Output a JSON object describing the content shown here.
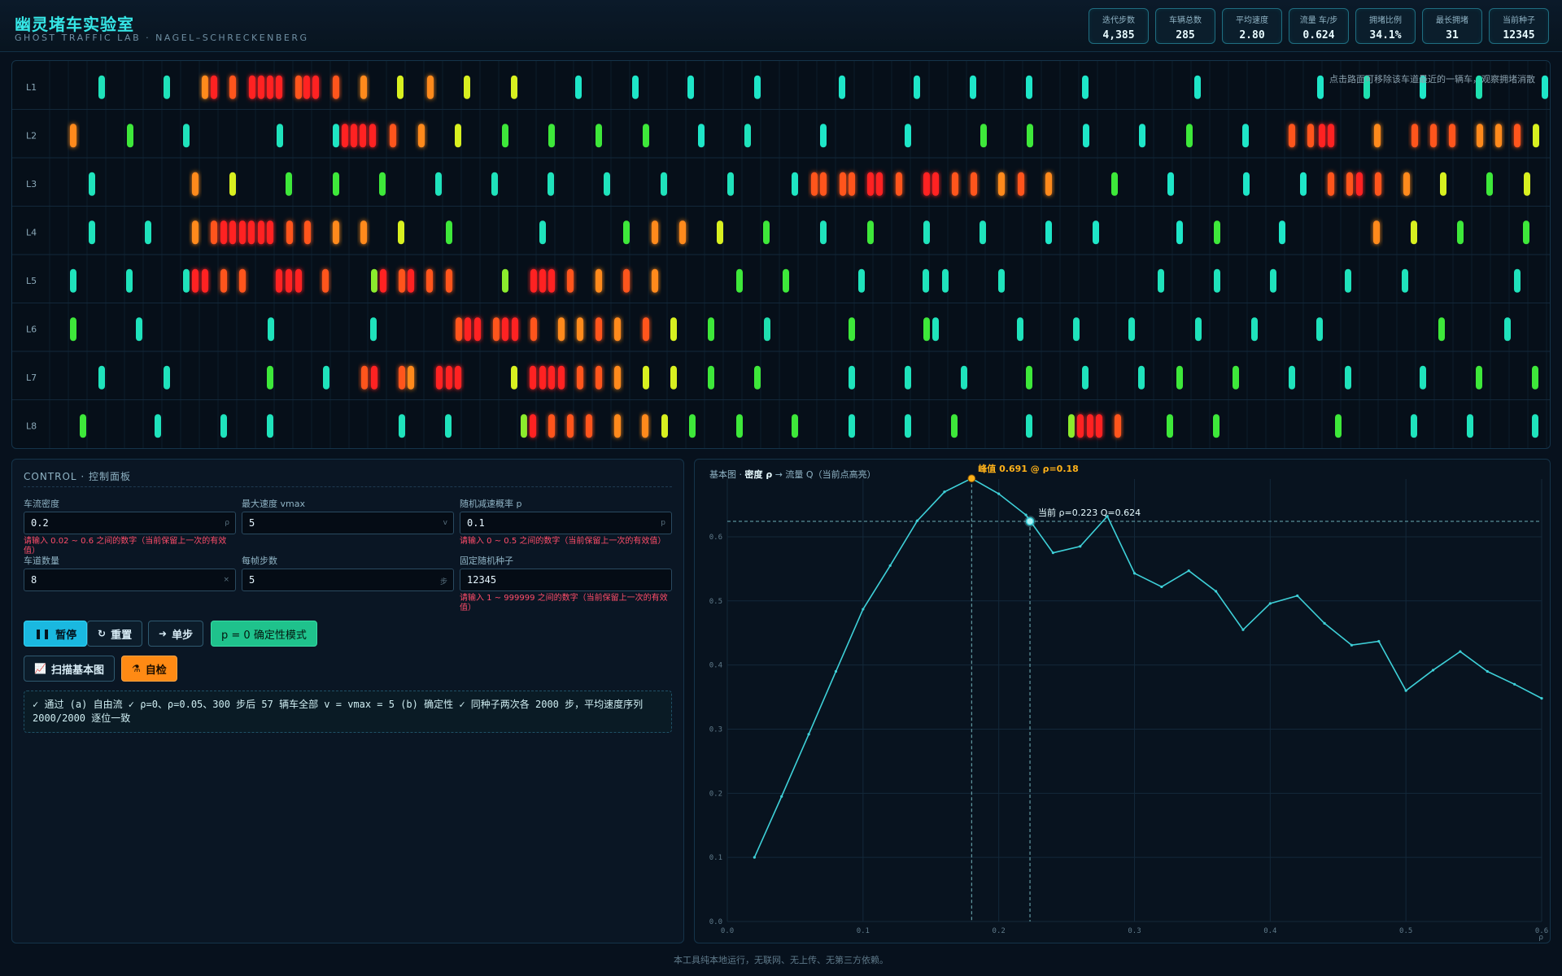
{
  "app": {
    "title": "幽灵堵车实验室",
    "subtitle": "GHOST TRAFFIC LAB · NAGEL–SCHRECKENBERG"
  },
  "stats": [
    {
      "label": "迭代步数",
      "value": "4,385"
    },
    {
      "label": "车辆总数",
      "value": "285"
    },
    {
      "label": "平均速度",
      "value": "2.80"
    },
    {
      "label": "流量 车/步",
      "value": "0.624"
    },
    {
      "label": "拥堵比例",
      "value": "34.1%"
    },
    {
      "label": "最长拥堵",
      "value": "31"
    },
    {
      "label": "当前种子",
      "value": "12345"
    }
  ],
  "road": {
    "hint": "点击路面可移除该车道最近的一辆车，观察拥堵消散",
    "lane_labels": [
      "L1",
      "L2",
      "L3",
      "L4",
      "L5",
      "L6",
      "L7",
      "L8"
    ],
    "cars": [
      [
        [
          124,
          0.6
        ],
        [
          204,
          0.6
        ],
        [
          251,
          4
        ],
        [
          262,
          5
        ],
        [
          285,
          4.5
        ],
        [
          309,
          5
        ],
        [
          320,
          5
        ],
        [
          331,
          5
        ],
        [
          342,
          5
        ],
        [
          366,
          4.5
        ],
        [
          376,
          5
        ],
        [
          387,
          5
        ],
        [
          412,
          4.5
        ],
        [
          446,
          4
        ],
        [
          491,
          3
        ],
        [
          528,
          4
        ],
        [
          573,
          3
        ],
        [
          631,
          3
        ],
        [
          710,
          0
        ],
        [
          780,
          0
        ],
        [
          848,
          0
        ],
        [
          930,
          0
        ],
        [
          1034,
          0
        ],
        [
          1126,
          0
        ],
        [
          1195,
          0
        ],
        [
          1264,
          0
        ],
        [
          1333,
          0
        ],
        [
          1471,
          0
        ],
        [
          1622,
          0
        ],
        [
          1679,
          1
        ],
        [
          1748,
          0
        ],
        [
          1817,
          1
        ],
        [
          1898,
          0
        ]
      ],
      [
        [
          89,
          4
        ],
        [
          159,
          2
        ],
        [
          228,
          0.5
        ],
        [
          343,
          0.5
        ],
        [
          412,
          0.2
        ],
        [
          423,
          5
        ],
        [
          434,
          5
        ],
        [
          445,
          5
        ],
        [
          457,
          5
        ],
        [
          482,
          4.5
        ],
        [
          517,
          4
        ],
        [
          562,
          3
        ],
        [
          620,
          2
        ],
        [
          677,
          2
        ],
        [
          735,
          2
        ],
        [
          793,
          2
        ],
        [
          861,
          0
        ],
        [
          918,
          0.5
        ],
        [
          1011,
          0
        ],
        [
          1115,
          0
        ],
        [
          1208,
          2
        ],
        [
          1265,
          2
        ],
        [
          1334,
          0
        ],
        [
          1403,
          0
        ],
        [
          1461,
          2
        ],
        [
          1530,
          0
        ],
        [
          1587,
          4.5
        ],
        [
          1610,
          4.5
        ],
        [
          1624,
          5
        ],
        [
          1635,
          5
        ],
        [
          1692,
          4
        ],
        [
          1738,
          4.5
        ],
        [
          1761,
          4.5
        ],
        [
          1784,
          4.5
        ],
        [
          1818,
          4
        ],
        [
          1841,
          4
        ],
        [
          1864,
          4.5
        ],
        [
          1887,
          3
        ]
      ]
    ],
    "cars_more": [
      [
        [
          112,
          0.5
        ],
        [
          239,
          4
        ],
        [
          285,
          3
        ],
        [
          354,
          2
        ],
        [
          412,
          2
        ],
        [
          469,
          2
        ],
        [
          538,
          0.5
        ],
        [
          607,
          0.5
        ],
        [
          676,
          0.5
        ],
        [
          745,
          0.5
        ],
        [
          815,
          0.5
        ],
        [
          897,
          0.5
        ],
        [
          976,
          0.2
        ],
        [
          1000,
          4.5
        ],
        [
          1011,
          4.5
        ],
        [
          1035,
          4.5
        ],
        [
          1046,
          4.5
        ],
        [
          1069,
          5
        ],
        [
          1080,
          5
        ],
        [
          1104,
          4.5
        ],
        [
          1138,
          5
        ],
        [
          1149,
          5
        ],
        [
          1173,
          4.5
        ],
        [
          1196,
          4.5
        ],
        [
          1230,
          4
        ],
        [
          1254,
          4.5
        ],
        [
          1288,
          4
        ],
        [
          1369,
          2
        ],
        [
          1438,
          0
        ],
        [
          1531,
          0
        ],
        [
          1601,
          0
        ],
        [
          1635,
          4.5
        ],
        [
          1658,
          4.5
        ],
        [
          1670,
          5
        ],
        [
          1693,
          4.5
        ],
        [
          1728,
          4
        ],
        [
          1773,
          3
        ],
        [
          1830,
          2
        ],
        [
          1876,
          3
        ]
      ],
      [
        [
          112,
          0.5
        ],
        [
          181,
          0.5
        ],
        [
          239,
          4
        ],
        [
          262,
          4.5
        ],
        [
          274,
          5
        ],
        [
          285,
          5
        ],
        [
          297,
          5
        ],
        [
          308,
          5
        ],
        [
          320,
          5
        ],
        [
          331,
          5
        ],
        [
          355,
          4.5
        ],
        [
          377,
          4.5
        ],
        [
          412,
          4
        ],
        [
          446,
          4
        ],
        [
          492,
          3
        ],
        [
          551,
          2
        ],
        [
          666,
          0.5
        ],
        [
          769,
          2
        ],
        [
          804,
          4
        ],
        [
          838,
          4
        ],
        [
          884,
          3
        ],
        [
          941,
          2
        ],
        [
          1011,
          0.5
        ],
        [
          1069,
          2
        ],
        [
          1138,
          0.5
        ],
        [
          1207,
          0.5
        ],
        [
          1288,
          0
        ],
        [
          1346,
          0
        ],
        [
          1449,
          0
        ],
        [
          1495,
          2
        ],
        [
          1575,
          0
        ],
        [
          1691,
          4
        ],
        [
          1737,
          3
        ],
        [
          1794,
          2
        ],
        [
          1875,
          2
        ]
      ],
      [
        [
          89,
          0.5
        ],
        [
          158,
          0.5
        ],
        [
          228,
          0.5
        ],
        [
          239,
          5
        ],
        [
          251,
          5
        ],
        [
          274,
          4.5
        ],
        [
          297,
          4.5
        ],
        [
          342,
          5
        ],
        [
          354,
          5
        ],
        [
          366,
          5
        ],
        [
          399,
          4.5
        ],
        [
          459,
          2.5
        ],
        [
          470,
          5
        ],
        [
          493,
          4.5
        ],
        [
          504,
          5
        ],
        [
          527,
          4.5
        ],
        [
          551,
          4.5
        ],
        [
          620,
          2.5
        ],
        [
          655,
          5
        ],
        [
          666,
          5
        ],
        [
          677,
          5
        ],
        [
          700,
          4.5
        ],
        [
          735,
          4
        ],
        [
          769,
          4.5
        ],
        [
          804,
          4
        ],
        [
          908,
          2
        ],
        [
          965,
          2
        ],
        [
          1058,
          0.5
        ],
        [
          1137,
          0.5
        ],
        [
          1161,
          0.5
        ],
        [
          1230,
          0.5
        ],
        [
          1426,
          0.5
        ],
        [
          1495,
          0.5
        ],
        [
          1564,
          0.5
        ],
        [
          1656,
          0.5
        ],
        [
          1726,
          0.5
        ],
        [
          1864,
          0.5
        ]
      ],
      [
        [
          89,
          2
        ],
        [
          170,
          0.5
        ],
        [
          332,
          0.5
        ],
        [
          458,
          0.5
        ],
        [
          563,
          4.5
        ],
        [
          574,
          5
        ],
        [
          586,
          5
        ],
        [
          609,
          4.5
        ],
        [
          620,
          5
        ],
        [
          632,
          5
        ],
        [
          655,
          4.5
        ],
        [
          689,
          4
        ],
        [
          712,
          4
        ],
        [
          735,
          4.5
        ],
        [
          758,
          4
        ],
        [
          793,
          4.5
        ],
        [
          827,
          3
        ],
        [
          873,
          2
        ],
        [
          942,
          1
        ],
        [
          1046,
          2
        ],
        [
          1138,
          2
        ],
        [
          1149,
          0.5
        ],
        [
          1253,
          0.5
        ],
        [
          1322,
          0.5
        ],
        [
          1390,
          0.5
        ],
        [
          1472,
          0.5
        ],
        [
          1541,
          0.5
        ],
        [
          1621,
          0.5
        ],
        [
          1771,
          2
        ],
        [
          1852,
          0.5
        ]
      ],
      [
        [
          124,
          0.5
        ],
        [
          204,
          0.5
        ],
        [
          331,
          2
        ],
        [
          400,
          0.5
        ],
        [
          447,
          4.5
        ],
        [
          459,
          5
        ],
        [
          493,
          4.5
        ],
        [
          504,
          4
        ],
        [
          539,
          5
        ],
        [
          551,
          5
        ],
        [
          562,
          5
        ],
        [
          631,
          3
        ],
        [
          654,
          5
        ],
        [
          666,
          5
        ],
        [
          677,
          5
        ],
        [
          689,
          5
        ],
        [
          712,
          4.5
        ],
        [
          735,
          4.5
        ],
        [
          758,
          4
        ],
        [
          793,
          3
        ],
        [
          827,
          3
        ],
        [
          873,
          2
        ],
        [
          930,
          2
        ],
        [
          1046,
          0.5
        ],
        [
          1115,
          0.5
        ],
        [
          1184,
          0.5
        ],
        [
          1264,
          2
        ],
        [
          1333,
          0.5
        ],
        [
          1402,
          0.5
        ],
        [
          1449,
          2
        ],
        [
          1518,
          2
        ],
        [
          1587,
          0.5
        ],
        [
          1656,
          0.5
        ],
        [
          1748,
          0.5
        ],
        [
          1817,
          2
        ],
        [
          1886,
          2
        ]
      ],
      [
        [
          101,
          2
        ],
        [
          193,
          0.5
        ],
        [
          274,
          0.5
        ],
        [
          331,
          0.5
        ],
        [
          493,
          0.5
        ],
        [
          550,
          0.5
        ],
        [
          643,
          2.5
        ],
        [
          654,
          5
        ],
        [
          677,
          4.5
        ],
        [
          700,
          4.5
        ],
        [
          723,
          4.5
        ],
        [
          758,
          4
        ],
        [
          792,
          4
        ],
        [
          816,
          3
        ],
        [
          850,
          2
        ],
        [
          908,
          2
        ],
        [
          976,
          2
        ],
        [
          1046,
          0.5
        ],
        [
          1115,
          0.5
        ],
        [
          1172,
          2
        ],
        [
          1264,
          0.5
        ],
        [
          1316,
          2.5
        ],
        [
          1327,
          5
        ],
        [
          1339,
          5
        ],
        [
          1350,
          5
        ],
        [
          1373,
          4.5
        ],
        [
          1437,
          2
        ],
        [
          1494,
          2
        ],
        [
          1644,
          2
        ],
        [
          1737,
          0.5
        ],
        [
          1806,
          0.5
        ],
        [
          1886,
          0.5
        ]
      ]
    ]
  },
  "controls": {
    "title": "CONTROL · 控制面板",
    "fields": [
      {
        "label": "车流密度",
        "value": "0.2",
        "unit": "ρ",
        "error": "请输入 0.02 ~ 0.6 之间的数字（当前保留上一次的有效值）"
      },
      {
        "label": "最大速度 vmax",
        "value": "5",
        "unit": "v",
        "error": ""
      },
      {
        "label": "随机减速概率 p",
        "value": "0.1",
        "unit": "p",
        "error": "请输入 0 ~ 0.5 之间的数字（当前保留上一次的有效值）"
      },
      {
        "label": "车道数量",
        "value": "8",
        "unit": "×",
        "error": ""
      },
      {
        "label": "每帧步数",
        "value": "5",
        "unit": "步",
        "error": ""
      },
      {
        "label": "固定随机种子",
        "value": "12345",
        "unit": "",
        "error": "请输入 1 ~ 999999 之间的数字（当前保留上一次的有效值）"
      }
    ],
    "buttons": {
      "pause": "暂停",
      "reset": "重置",
      "step": "单步",
      "deterministic": "p = 0 确定性模式",
      "sweep": "扫描基本图",
      "selftest": "自检"
    },
    "result": "✓ 通过 (a) 自由流 ✓ ρ=0、ρ=0.05、300 步后 57 辆车全部 v = vmax = 5 (b) 确定性 ✓ 同种子两次各 2000 步，平均速度序列 2000/2000 逐位一致"
  },
  "chart_data": {
    "type": "line",
    "title": "基本图 · 密度 ρ → 流量 Q（当前点高亮）",
    "title_parts": {
      "prefix": "基本图 · ",
      "em": "密度 ρ",
      "suffix": " → 流量 Q（当前点高亮）"
    },
    "xlabel": "ρ",
    "ylabel": "",
    "xlim": [
      0,
      0.6
    ],
    "ylim": [
      0,
      0.69
    ],
    "xticks": [
      "0.0",
      "0.1",
      "0.2",
      "0.3",
      "0.4",
      "0.5",
      "0.6"
    ],
    "yticks": [
      "0.0",
      "0.1",
      "0.2",
      "0.3",
      "0.4",
      "0.5",
      "0.6"
    ],
    "grid": true,
    "color": "#3ed0d8",
    "peak_color": "#ffb21a",
    "series": [
      {
        "x": [
          0.02,
          0.04,
          0.06,
          0.08,
          0.1,
          0.12,
          0.14,
          0.16,
          0.18,
          0.2,
          0.22,
          0.24,
          0.26,
          0.28,
          0.3,
          0.32,
          0.34,
          0.36,
          0.38,
          0.4,
          0.42,
          0.44,
          0.46,
          0.48,
          0.5,
          0.52,
          0.54,
          0.56,
          0.58,
          0.6
        ],
        "y": [
          0.1,
          0.195,
          0.292,
          0.39,
          0.487,
          0.555,
          0.625,
          0.67,
          0.691,
          0.667,
          0.634,
          0.575,
          0.585,
          0.632,
          0.543,
          0.522,
          0.547,
          0.515,
          0.455,
          0.496,
          0.508,
          0.465,
          0.431,
          0.437,
          0.36,
          0.392,
          0.421,
          0.39,
          0.37,
          0.348
        ]
      }
    ],
    "peak": {
      "x": 0.18,
      "y": 0.691,
      "label": "峰值 0.691 @ ρ=0.18"
    },
    "current": {
      "x": 0.223,
      "y": 0.624,
      "label": "当前 ρ=0.223  Q=0.624"
    }
  },
  "footer": "本工具纯本地运行，无联网、无上传、无第三方依赖。"
}
